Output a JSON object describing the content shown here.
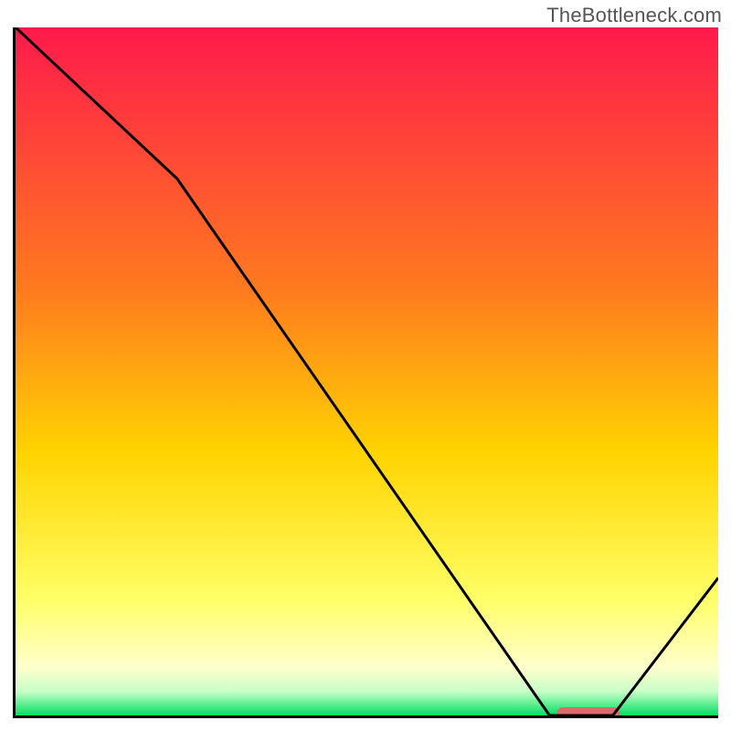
{
  "watermark": "TheBottleneck.com",
  "chart_data": {
    "type": "line",
    "title": "",
    "xlabel": "",
    "ylabel": "",
    "xlim": [
      0,
      100
    ],
    "ylim": [
      0,
      100
    ],
    "x": [
      0,
      23,
      76,
      80,
      85,
      100
    ],
    "values": [
      100,
      78,
      0,
      0,
      0,
      20
    ],
    "gradient_stops": [
      {
        "offset": 0.0,
        "color": "#ff1a4b"
      },
      {
        "offset": 0.38,
        "color": "#ff7a1f"
      },
      {
        "offset": 0.62,
        "color": "#ffd400"
      },
      {
        "offset": 0.83,
        "color": "#ffff66"
      },
      {
        "offset": 0.93,
        "color": "#ffffcc"
      },
      {
        "offset": 0.965,
        "color": "#c8ffc8"
      },
      {
        "offset": 1.0,
        "color": "#00e060"
      }
    ],
    "marker": {
      "x_start": 77,
      "x_end": 86,
      "y": 0,
      "color": "#d96b6b"
    }
  }
}
